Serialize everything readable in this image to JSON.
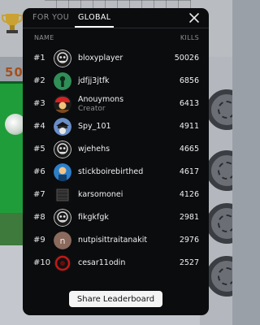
{
  "background": {
    "score_partial": "50"
  },
  "tabs": [
    {
      "label": "FOR YOU",
      "active": false
    },
    {
      "label": "GLOBAL",
      "active": true
    }
  ],
  "columns": {
    "name": "NAME",
    "kills": "KILLS"
  },
  "rows": [
    {
      "rank": "#1",
      "name": "bloxyplayer",
      "kills": "50026",
      "avatar": "skull-face-icon"
    },
    {
      "rank": "#2",
      "name": "jdfjj3jtfk",
      "kills": "6856",
      "avatar": "green-character-icon"
    },
    {
      "rank": "#3",
      "name": "Anouymons",
      "subtitle": "Creator",
      "kills": "6413",
      "avatar": "red-character-icon"
    },
    {
      "rank": "#4",
      "name": "Spy_101",
      "kills": "4911",
      "avatar": "spy-character-icon"
    },
    {
      "rank": "#5",
      "name": "wjehehs",
      "kills": "4665",
      "avatar": "skull-face-icon"
    },
    {
      "rank": "#6",
      "name": "stickboirebirthed",
      "kills": "4617",
      "avatar": "blue-character-icon"
    },
    {
      "rank": "#7",
      "name": "karsomonei",
      "kills": "4126",
      "avatar": "dark-block-icon"
    },
    {
      "rank": "#8",
      "name": "fikgkfgk",
      "kills": "2981",
      "avatar": "skull-face-icon"
    },
    {
      "rank": "#9",
      "name": "nutpisittraitanakit",
      "kills": "2976",
      "avatar": "letter-n-icon",
      "avatar_letter": "n"
    },
    {
      "rank": "#10",
      "name": "cesar11odin",
      "kills": "2527",
      "avatar": "red-ring-icon"
    }
  ],
  "share_label": "Share Leaderboard",
  "colors": {
    "panel": "#0b0c0e",
    "muted": "#8e8f93",
    "text": "#f0f0f0",
    "button": "#f4f4f4"
  }
}
